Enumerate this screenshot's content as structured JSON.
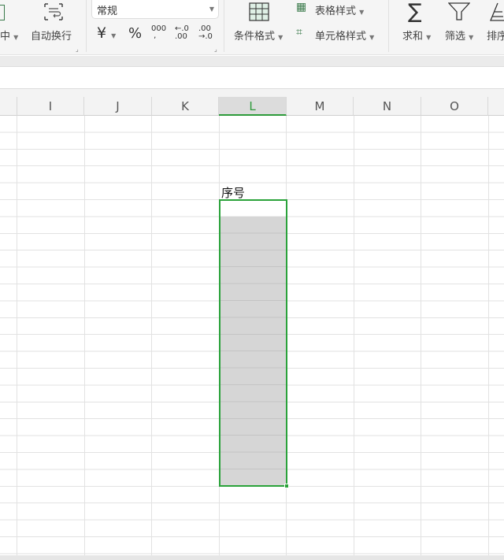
{
  "ribbon": {
    "merge_center": "中",
    "wrap_text": "自动换行",
    "number_format": "常规",
    "currency_symbol": "¥",
    "percent": "%",
    "thousands": "000",
    "increase_decimal": "←.0\n.00",
    "decrease_decimal": ".00\n→.0",
    "conditional_format": "条件格式",
    "table_style": "表格样式",
    "cell_style": "单元格样式",
    "sum": "求和",
    "filter": "筛选",
    "sort": "排序"
  },
  "columns": [
    "I",
    "J",
    "K",
    "L",
    "M",
    "N",
    "O"
  ],
  "selected_column": "L",
  "cells": {
    "L_header": "序号"
  },
  "accent": "#2aa23a"
}
